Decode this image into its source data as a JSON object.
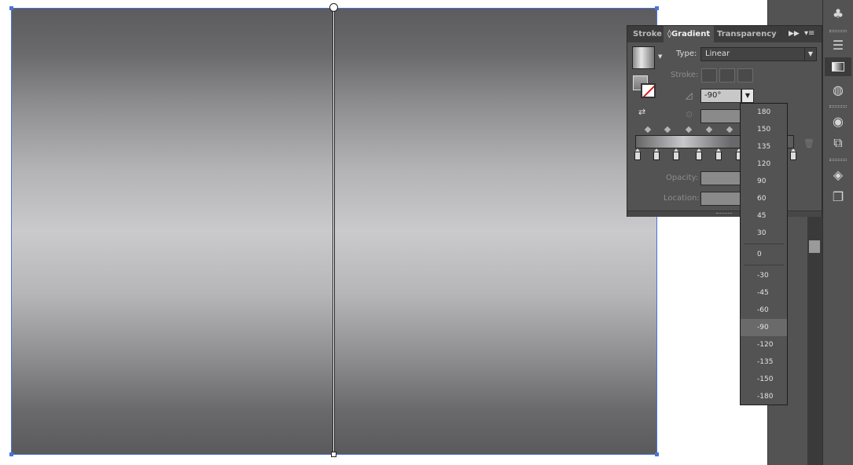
{
  "panel": {
    "tabs": [
      {
        "label": "Stroke"
      },
      {
        "label": "Gradient",
        "prefix": "◊"
      },
      {
        "label": "Transparency"
      }
    ],
    "type_label": "Type:",
    "type_value": "Linear",
    "stroke_label": "Stroke:",
    "angle_value": "-90°",
    "opacity_label": "Opacity:",
    "location_label": "Location:"
  },
  "angle_dropdown": {
    "options": [
      "180",
      "150",
      "135",
      "120",
      "90",
      "60",
      "45",
      "30",
      "0",
      "-30",
      "-45",
      "-60",
      "-90",
      "-120",
      "-135",
      "-150",
      "-180"
    ],
    "selected": "-90"
  },
  "icons": [
    "clubs-icon",
    "paragraph-lines-icon",
    "gradient-icon",
    "transparency-icon",
    "appearance-icon",
    "export-icon",
    "layers-icon",
    "artboards-icon"
  ],
  "colors": {
    "selection": "#4a74d6",
    "panel_bg": "#535353",
    "tab_bar": "#3c3c3c"
  }
}
